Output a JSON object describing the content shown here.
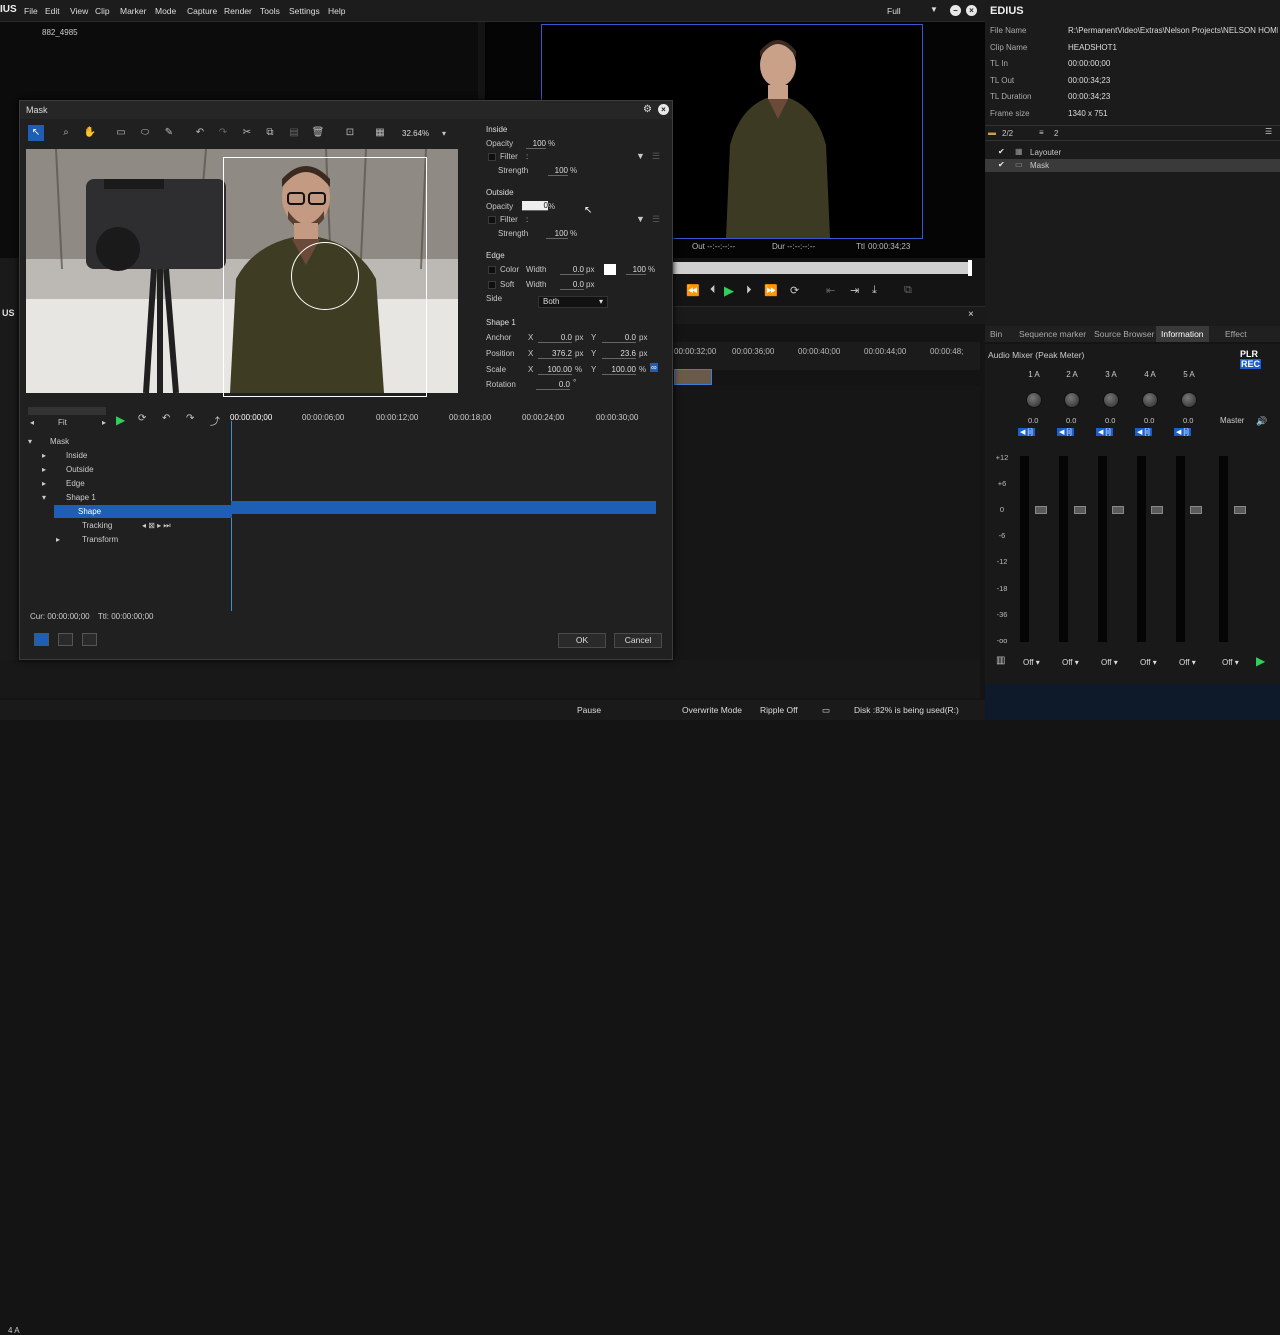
{
  "menubar": {
    "app_logo": "IUS",
    "items": [
      "File",
      "Edit",
      "View",
      "Clip",
      "Marker",
      "Mode",
      "Capture",
      "Render",
      "Tools",
      "Settings",
      "Help"
    ],
    "display_mode": "Full"
  },
  "player_left": {
    "clip_label": "882_4985"
  },
  "player_right": {
    "timecode_out": "Out --:--:--:--",
    "timecode_dur": "Dur --:--:--:--",
    "timecode_ttl_label": "Ttl",
    "timecode_ttl": "00:00:34;23"
  },
  "timeline": {
    "panel_label": "US",
    "ruler": [
      "00:00:32;00",
      "00:00:36;00",
      "00:00:40;00",
      "00:00:44;00",
      "00:00:48;"
    ],
    "track_4a": "4 A"
  },
  "status": {
    "pause": "Pause",
    "overwrite": "Overwrite Mode",
    "ripple": "Ripple Off",
    "disk": "Disk :82% is being used(R:)"
  },
  "info_panel": {
    "title": "EDIUS",
    "rows": [
      {
        "k": "File Name",
        "v": "R:\\PermanentVideo\\Extras\\Nelson Projects\\NELSON HOMEWO..."
      },
      {
        "k": "Clip Name",
        "v": "HEADSHOT1"
      },
      {
        "k": "TL In",
        "v": "00:00:00;00"
      },
      {
        "k": "TL Out",
        "v": "00:00:34;23"
      },
      {
        "k": "TL Duration",
        "v": "00:00:34;23"
      },
      {
        "k": "Frame size",
        "v": "1340 x 751"
      }
    ],
    "layer_count": "2/2",
    "layer_count2": "2",
    "layers": [
      "Layouter",
      "Mask"
    ]
  },
  "tabs": [
    "Bin",
    "Sequence marker",
    "Source Browser",
    "Information",
    "Effect"
  ],
  "active_tab": "Information",
  "mixer": {
    "title": "Audio Mixer (Peak Meter)",
    "plr": "PLR",
    "rec": "REC",
    "channels": [
      "1 A",
      "2 A",
      "3 A",
      "4 A",
      "5 A"
    ],
    "master": "Master",
    "db_scale": [
      "+12",
      "+6",
      "0",
      "-6",
      "-12",
      "-18",
      "-36",
      "-oo"
    ],
    "zero_value": "0.0",
    "off_label": "Off"
  },
  "mask_dialog": {
    "title": "Mask",
    "zoom": "32.64%",
    "inside_header": "Inside",
    "outside_header": "Outside",
    "edge_header": "Edge",
    "shape_header": "Shape 1",
    "labels": {
      "opacity": "Opacity",
      "filter": "Filter",
      "strength": "Strength",
      "color": "Color",
      "width": "Width",
      "soft": "Soft",
      "side": "Side",
      "anchor": "Anchor",
      "position": "Position",
      "scale": "Scale",
      "rotation": "Rotation",
      "x": "X",
      "y": "Y",
      "px": "px",
      "pct": "%",
      "deg": "°",
      "colon": ":"
    },
    "inside": {
      "opacity": "100",
      "strength": "100"
    },
    "outside": {
      "opacity": "0",
      "strength": "100"
    },
    "edge": {
      "color_width": "0.0",
      "color_pct": "100",
      "soft_width": "0.0",
      "side": "Both"
    },
    "shape": {
      "anchor_x": "0.0",
      "anchor_y": "0.0",
      "pos_x": "376.2",
      "pos_y": "23.6",
      "scale_x": "100.00",
      "scale_y": "100.00",
      "rotation": "0.0"
    },
    "fit": "Fit",
    "kf_ruler": [
      "00:00:00;00",
      "00:00:06;00",
      "00:00:12;00",
      "00:00:18;00",
      "00:00:24;00",
      "00:00:30;00"
    ],
    "tree": [
      "Mask",
      "Inside",
      "Outside",
      "Edge",
      "Shape 1",
      "Shape",
      "Tracking",
      "Transform"
    ],
    "cur_label": "Cur:",
    "cur_tc": "00:00:00;00",
    "ttl_label": "Ttl:",
    "ttl_tc": "00:00:00;00",
    "ok": "OK",
    "cancel": "Cancel"
  }
}
